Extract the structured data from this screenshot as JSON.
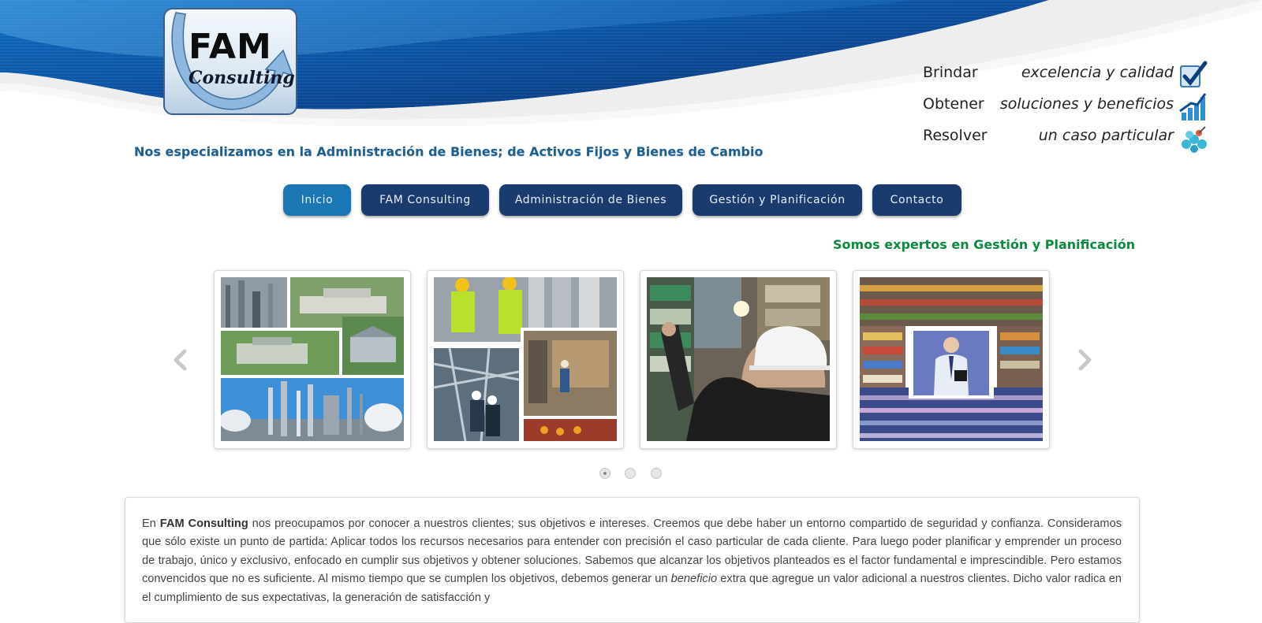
{
  "logo": {
    "line1": "FAM",
    "line2": "Consulting"
  },
  "taglines": [
    {
      "verb": "Brindar",
      "phrase": "excelencia y calidad",
      "icon": "checkmark-icon"
    },
    {
      "verb": "Obtener",
      "phrase": "soluciones y beneficios",
      "icon": "growth-chart-icon"
    },
    {
      "verb": "Resolver",
      "phrase": "un caso particular",
      "icon": "molecule-icon"
    }
  ],
  "specialize_text": "Nos especializamos en la Administración de Bienes; de Activos Fijos y Bienes de Cambio",
  "nav": {
    "items": [
      {
        "label": "Inicio",
        "active": true
      },
      {
        "label": "FAM Consulting"
      },
      {
        "label": "Administración de Bienes"
      },
      {
        "label": "Gestión y Planificación"
      },
      {
        "label": "Contacto"
      }
    ]
  },
  "experts_text": "Somos expertos en Gestión y Planificación",
  "carousel": {
    "prev_icon": "chevron-left-icon",
    "next_icon": "chevron-right-icon",
    "slides_total": 3,
    "slide_active": 1
  },
  "intro": {
    "p1_pre": "En ",
    "p1_brand": "FAM Consulting",
    "p1_main": " nos preocupamos por conocer a nuestros clientes; sus objetivos e intereses. Creemos que debe haber un entorno compartido de seguridad y confianza. Consideramos que sólo existe un punto de partida: Aplicar todos los recursos necesarios para entender con precisión el caso particular de cada cliente. Para luego poder planificar y emprender un proceso de trabajo, único y exclusivo, enfocado en cumplir sus objetivos y obtener soluciones. Sabemos que alcanzar los objetivos planteados es el factor fundamental e imprescindible. Pero estamos convencidos que no es suficiente. Al mismo tiempo que se cumplen los objetivos, debemos generar un ",
    "p1_em": "beneficio",
    "p1_tail": " extra que agregue un valor adicional a nuestros clientes. Dicho valor radica en el cumplimiento de sus expectativas, la generación de satisfacción y"
  },
  "colors": {
    "nav_bg": "#1a3b6e",
    "nav_active": "#1a77b3",
    "specialize": "#1f5f8f",
    "experts": "#0a8a3e"
  }
}
